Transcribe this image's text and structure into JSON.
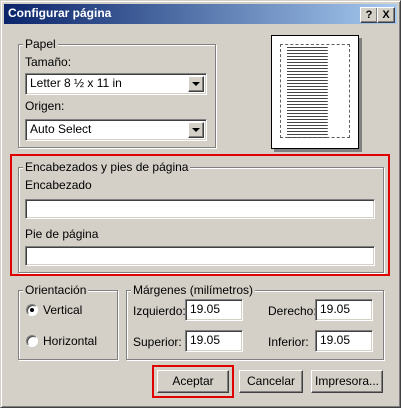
{
  "window": {
    "title": "Configurar página",
    "help_label": "?",
    "close_label": "X"
  },
  "paper": {
    "legend": "Papel",
    "size_label": "Tamaño:",
    "size_value": "Letter 8 ½ x 11 in",
    "source_label": "Origen:",
    "source_value": "Auto Select"
  },
  "headers": {
    "legend": "Encabezados y pies de página",
    "header_label": "Encabezado",
    "header_value": "",
    "footer_label": "Pie de página",
    "footer_value": ""
  },
  "orientation": {
    "legend": "Orientación",
    "options": [
      {
        "label": "Vertical",
        "selected": true
      },
      {
        "label": "Horizontal",
        "selected": false
      }
    ]
  },
  "margins": {
    "legend": "Márgenes (milímetros)",
    "left_label": "Izquierdo:",
    "left_value": "19.05",
    "right_label": "Derecho:",
    "right_value": "19.05",
    "top_label": "Superior:",
    "top_value": "19.05",
    "bottom_label": "Inferior:",
    "bottom_value": "19.05"
  },
  "buttons": {
    "ok": "Aceptar",
    "cancel": "Cancelar",
    "printer": "Impresora..."
  },
  "colors": {
    "highlight": "#e00000",
    "titlebar_start": "#0a246a",
    "titlebar_end": "#a6caf0"
  }
}
